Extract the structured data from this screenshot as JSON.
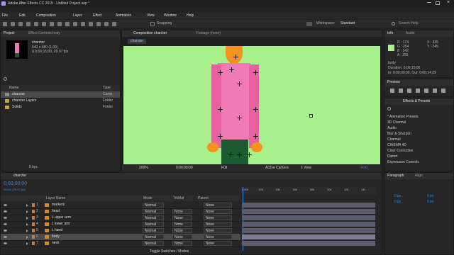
{
  "window": {
    "title": "Adobe After Effects CC 2015 - Untitled Project.aep *"
  },
  "menu": [
    "File",
    "Edit",
    "Composition",
    "Layer",
    "Effect",
    "Animation",
    "View",
    "Window",
    "Help"
  ],
  "toolbar": {
    "snapping": "Snapping",
    "workspace_label": "Workspace:",
    "workspace_value": "Standard",
    "search_placeholder": "Search Help"
  },
  "project": {
    "tab": "Project",
    "tab2": "Effect Controls body",
    "comp_name": "charcter",
    "comp_info1": "640 x 480 (1.00)",
    "comp_info2": "Δ 0;00;15;00, 29.97 fps",
    "col_name": "Name",
    "col_type": "Type",
    "items": [
      {
        "name": "charcter",
        "type": "Comp"
      },
      {
        "name": "charcter Layers",
        "type": "Folder"
      },
      {
        "name": "Solids",
        "type": "Folder"
      }
    ],
    "bpc": "8 bpc"
  },
  "viewer": {
    "tab": "Composition charcter",
    "tab2": "Footage (none)",
    "comp_tab": "charcter",
    "zoom": "200%",
    "timecode": "0;00;00;00",
    "resolution": "Full",
    "camera": "Active Camera",
    "views": "1 View",
    "offset": "+0.0"
  },
  "info": {
    "tab": "Info",
    "tab2": "Audio",
    "r": "R : 174",
    "g": "G : 254",
    "b": "B : 142",
    "a": "A : 255",
    "x": "X : 335",
    "y": "Y : 245",
    "layer": "body",
    "duration": "Duration: 0;00;15;00",
    "in_out": "In: 0;00;00;00, Out: 0;00;14;29"
  },
  "preview": {
    "tab": "Preview"
  },
  "effects": {
    "tab": "Effects & Presets",
    "items": [
      "* Animation Presets",
      "3D Channel",
      "Audio",
      "Blur & Sharpen",
      "Channel",
      "CINEMA 4D",
      "Color Correction",
      "Distort",
      "Expression Controls"
    ]
  },
  "paragraph": {
    "tab": "Paragraph",
    "tab2": "Align",
    "v1": "0 px",
    "v2": "0 px",
    "v3": "0 px",
    "v4": "0 px"
  },
  "timeline": {
    "tab": "charcter",
    "timecode": "0;00;00;00",
    "fps": "00000 (29.97 fps)",
    "col_layer": "Layer Name",
    "col_mode": "Mode",
    "col_trkmat": "TrkMat",
    "col_parent": "Parent",
    "toggle": "Toggle Switches / Modes",
    "ruler": [
      "0:00f",
      "02s",
      "04s",
      "06s",
      "08s",
      "10s",
      "12s",
      "14s"
    ],
    "layers": [
      {
        "num": "1",
        "name": "markers",
        "mode": "Normal",
        "trk": "",
        "parent": "None"
      },
      {
        "num": "2",
        "name": "head",
        "mode": "Normal",
        "trk": "None",
        "parent": "None"
      },
      {
        "num": "3",
        "name": "L upper arm",
        "mode": "Normal",
        "trk": "None",
        "parent": "None"
      },
      {
        "num": "4",
        "name": "L lower arm",
        "mode": "Normal",
        "trk": "None",
        "parent": "None"
      },
      {
        "num": "5",
        "name": "L hand",
        "mode": "Normal",
        "trk": "None",
        "parent": "None"
      },
      {
        "num": "6",
        "name": "body",
        "mode": "Normal",
        "trk": "None",
        "parent": "None"
      },
      {
        "num": "7",
        "name": "neck",
        "mode": "Normal",
        "trk": "None",
        "parent": "None"
      }
    ]
  },
  "colors": {
    "canvas": "#a8f08c",
    "body": "#f07ab4",
    "head": "#f5921e",
    "legs": "#1c5a32",
    "accent": "#2d8ceb"
  }
}
